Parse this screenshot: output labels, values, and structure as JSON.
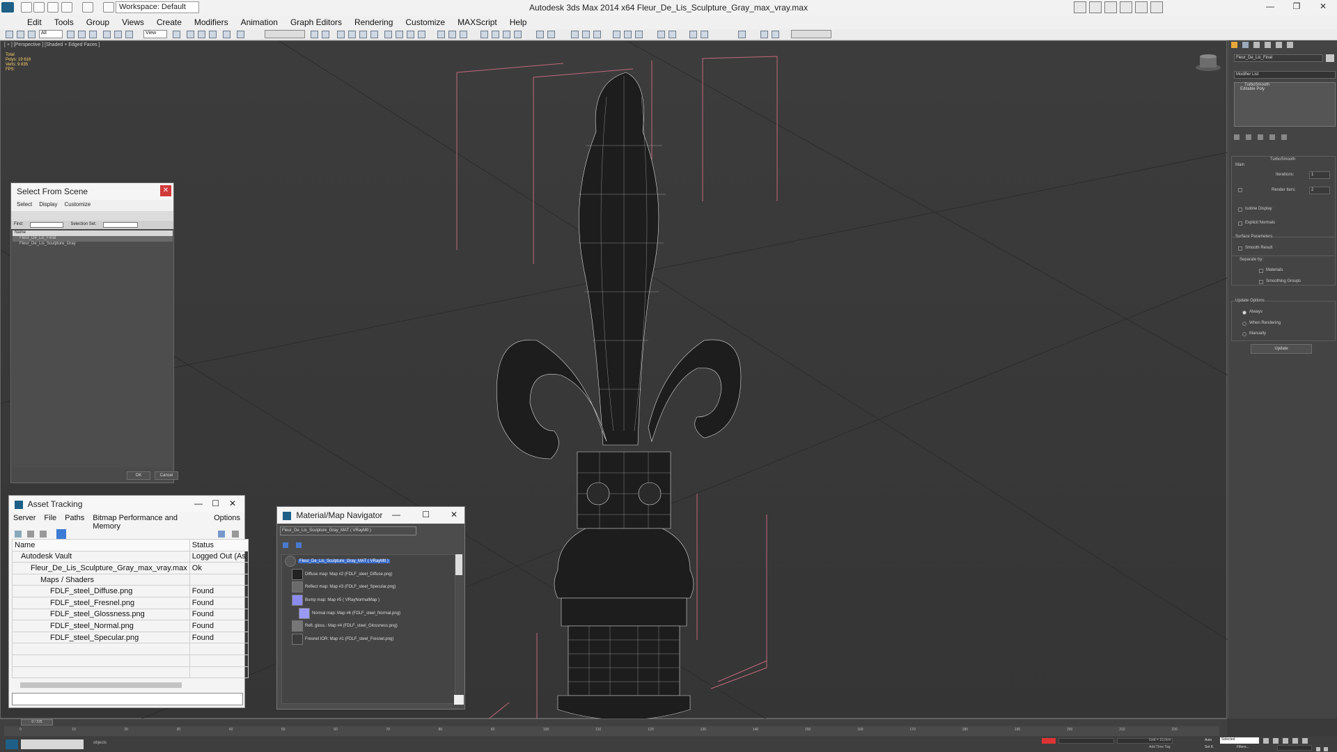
{
  "app": {
    "title": "Autodesk 3ds Max  2014 x64    Fleur_De_Lis_Sculpture_Gray_max_vray.max",
    "workspace": "Workspace: Default"
  },
  "menu": [
    "Edit",
    "Tools",
    "Group",
    "Views",
    "Create",
    "Modifiers",
    "Animation",
    "Graph Editors",
    "Rendering",
    "Customize",
    "MAXScript",
    "Help"
  ],
  "toolbar": {
    "selection_filter": "All",
    "reference_coord": "View"
  },
  "viewport": {
    "label": "[ + ] [Perspective ] [Shaded + Edged Faces ]",
    "stats": [
      "Total",
      "Polys:  19 616",
      "Verts:   9 835",
      "",
      "FPS:"
    ]
  },
  "select_from_scene": {
    "title": "Select From Scene",
    "menu": [
      "Select",
      "Display",
      "Customize"
    ],
    "find_label": "Find:",
    "selection_set_label": "Selection Set:",
    "column": "Name",
    "items": [
      "Fleur_De_Lis_Final",
      "Fleur_De_Lis_Sculpture_Gray"
    ],
    "ok": "OK",
    "cancel": "Cancel"
  },
  "asset_tracking": {
    "title": "Asset Tracking",
    "menu": [
      "Server",
      "File",
      "Paths",
      "Bitmap Performance and Memory",
      "Options"
    ],
    "columns": [
      "Name",
      "Status"
    ],
    "rows": [
      {
        "name": "Autodesk Vault",
        "status": "Logged Out (As"
      },
      {
        "name": "Fleur_De_Lis_Sculpture_Gray_max_vray.max",
        "status": "Ok"
      },
      {
        "name": "Maps / Shaders",
        "status": ""
      },
      {
        "name": "FDLF_steel_Diffuse.png",
        "status": "Found"
      },
      {
        "name": "FDLF_steel_Fresnel.png",
        "status": "Found"
      },
      {
        "name": "FDLF_steel_Glossness.png",
        "status": "Found"
      },
      {
        "name": "FDLF_steel_Normal.png",
        "status": "Found"
      },
      {
        "name": "FDLF_steel_Specular.png",
        "status": "Found"
      }
    ]
  },
  "material_navigator": {
    "title": "Material/Map Navigator",
    "field": "Fleur_De_Lis_Sculpture_Gray_MAT  ( VRayMtl )",
    "items": [
      "Fleur_De_Lis_Sculpture_Gray_MAT  ( VRayMtl )",
      "Diffuse map: Map #2 (FDLF_steel_Diffuse.png)",
      "Reflect map: Map #3 (FDLF_steel_Specular.png)",
      "Bump map: Map #5  ( VRayNormalMap )",
      "Normal map: Map #6 (FDLF_steel_Normal.png)",
      "Refl. gloss.: Map #4 (FDLF_steel_Glossness.png)",
      "Fresnel IOR: Map #1 (FDLF_steel_Fresnel.png)"
    ]
  },
  "command_panel": {
    "object_name": "Fleur_De_Lis_Final",
    "modifier_list": "Modifier List",
    "stack": [
      "TurboSmooth",
      "Editable Poly"
    ],
    "rollout": "TurboSmooth",
    "main": "Main",
    "iterations": "Iterations:",
    "iterations_value": "1",
    "render_iters": "Render Iters:",
    "render_iters_value": "2",
    "isoline": "Isoline Display",
    "explicit": "Explicit Normals",
    "surface": "Surface Parameters",
    "smooth": "Smooth Result",
    "separate": "Separate by:",
    "materials": "Materials",
    "smoothing_groups": "Smoothing Groups",
    "update_options": "Update Options",
    "always": "Always",
    "when_rendering": "When Rendering",
    "manually": "Manually",
    "update": "Update"
  },
  "timeline": {
    "frame": "0 / 225",
    "ticks": [
      "0",
      "10",
      "20",
      "30",
      "40",
      "50",
      "60",
      "70",
      "80",
      "90",
      "100",
      "110",
      "120",
      "130",
      "140",
      "150",
      "160",
      "170",
      "180",
      "190",
      "200",
      "210",
      "220"
    ]
  },
  "status": {
    "objects": "objects",
    "grid": "Grid = 10,0cm",
    "auto": "Auto",
    "selected": "Selected",
    "set_key": "Set K.",
    "filters": "Filters...",
    "add_time_tag": "Add Time Tag"
  }
}
